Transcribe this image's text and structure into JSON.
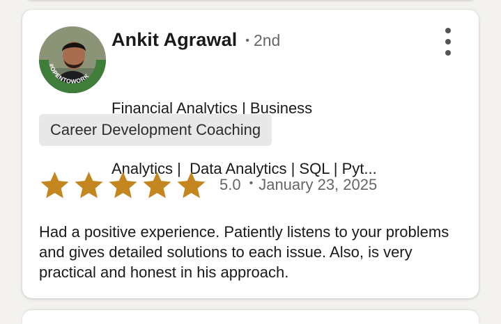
{
  "review_card": {
    "reviewer": {
      "name": "Ankit Agrawal",
      "degree": "2nd",
      "headline_lines": [
        "Financial Analytics | Business",
        "Analytics |  Data Analytics | SQL | Pyt..."
      ],
      "avatar_badge": "#OPENTOWORK"
    },
    "service_tag": "Career Development Coaching",
    "rating": {
      "value": "5.0",
      "stars": 5,
      "date": "January 23, 2025"
    },
    "review_text": "Had a positive experience. Patiently listens to your problems and gives detailed solutions to each issue. Also, is very practical and honest in his approach."
  },
  "colors": {
    "star": "#c4861e",
    "opentowork_ring": "#3f7d3a",
    "tag_bg": "#e8e8e8",
    "secondary_text": "#666666"
  },
  "icons": {
    "menu": "three-dots-vertical-icon",
    "star": "star-icon"
  }
}
